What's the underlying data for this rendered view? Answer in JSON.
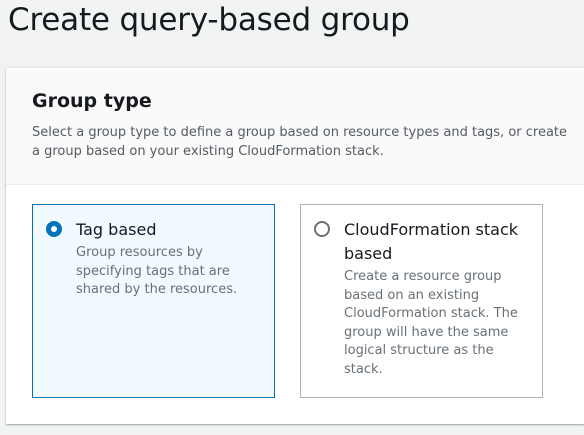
{
  "page": {
    "title": "Create query-based group"
  },
  "group_type": {
    "title": "Group type",
    "description": "Select a group type to define a group based on resource types and tags, or create a group based on your existing CloudFormation stack.",
    "options": [
      {
        "label": "Tag based",
        "description": "Group resources by specifying tags that are shared by the resources.",
        "selected": true
      },
      {
        "label": "CloudFormation stack based",
        "description": "Create a resource group based on an existing CloudFormation stack. The group will have the same logical structure as the stack.",
        "selected": false
      }
    ]
  },
  "colors": {
    "accent": "#0073bb",
    "selected_background": "#f1faff",
    "page_background": "#f2f3f3"
  }
}
